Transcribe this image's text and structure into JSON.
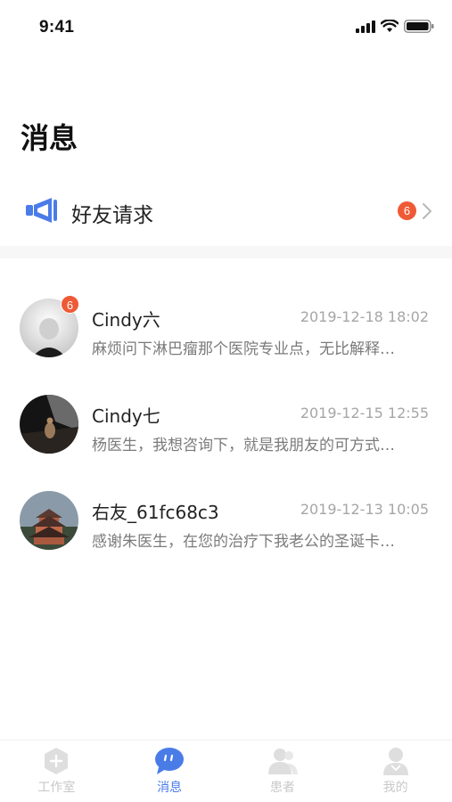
{
  "status_bar": {
    "time": "9:41"
  },
  "page": {
    "title": "消息"
  },
  "friend_request": {
    "label": "好友请求",
    "badge": "6",
    "icon": "megaphone-icon"
  },
  "messages": [
    {
      "name": "Cindy六",
      "time": "2019-12-18 18:02",
      "preview": "麻烦问下淋巴瘤那个医院专业点，无比解释…",
      "badge": "6"
    },
    {
      "name": "Cindy七",
      "time": "2019-12-15 12:55",
      "preview": "杨医生，我想咨询下，就是我朋友的可方式…"
    },
    {
      "name": "右友_61fc68c3",
      "time": "2019-12-13 10:05",
      "preview": "感谢朱医生，在您的治疗下我老公的圣诞卡…"
    }
  ],
  "tabs": [
    {
      "label": "工作室",
      "icon": "studio-icon",
      "active": false
    },
    {
      "label": "消息",
      "icon": "chat-icon",
      "active": true
    },
    {
      "label": "患者",
      "icon": "patients-icon",
      "active": false
    },
    {
      "label": "我的",
      "icon": "profile-icon",
      "active": false
    }
  ],
  "colors": {
    "accent": "#4a7ce8",
    "badge": "#ef5a36",
    "muted": "#a6a6a6"
  }
}
